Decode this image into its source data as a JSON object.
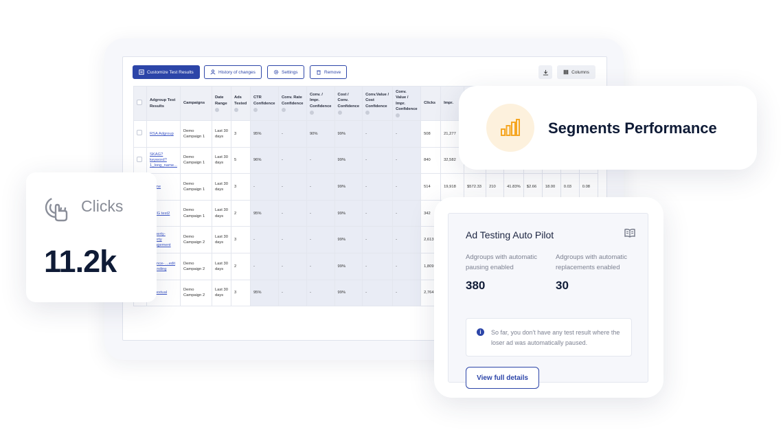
{
  "toolbar": {
    "customize": "Customize Test Results",
    "history": "History of changes",
    "settings": "Settings",
    "remove": "Remove",
    "columns": "Columns"
  },
  "table": {
    "headers": [
      "Adgroup Test Results",
      "Campaigns",
      "Date Range",
      "Ads Tested",
      "CTR Confidence",
      "Conv. Rate Confidence",
      "Conv. / Impr. Confidence",
      "Cost / Conv. Confidence",
      "Conv.Value / Cost Confidence",
      "Conv. Value / Impr. Confidence",
      "Clicks",
      "Impr."
    ],
    "rows": [
      [
        "RSA Adgroup",
        "Demo Campaign 1",
        "Last 30 days",
        "3",
        "95%",
        "-",
        "90%",
        "99%",
        "-",
        "-",
        "508",
        "21,277"
      ],
      [
        "SKAG? keyword?1_long_name...",
        "Demo Campaign 1",
        "Last 30 days",
        "5",
        "96%",
        "-",
        "-",
        "99%",
        "-",
        "-",
        "840",
        "32,582"
      ],
      [
        "...eme",
        "Demo Campaign 1",
        "Last 30 days",
        "3",
        "-",
        "-",
        "-",
        "99%",
        "-",
        "-",
        "514",
        "19,918",
        "$572.33",
        "210",
        "41.83%",
        "$2.66",
        "18.00",
        "0.03",
        "0.08"
      ],
      [
        "...ING test2",
        "Demo Campaign 1",
        "Last 30 days",
        "2",
        "95%",
        "-",
        "-",
        "99%",
        "-",
        "-",
        "342",
        ""
      ],
      [
        "...operty- ...perty ...nagement",
        "Demo Campaign 2",
        "Last 30 days",
        "3",
        "-",
        "-",
        "-",
        "99%",
        "-",
        "-",
        "2,613",
        ""
      ],
      [
        "...rance- ...edit & ...nding",
        "Demo Campaign 2",
        "Last 30 days",
        "2",
        "-",
        "-",
        "-",
        "99%",
        "-",
        "-",
        "1,809",
        ""
      ],
      [
        "...ntextual",
        "Demo Campaign 2",
        "Last 30 days",
        "3",
        "95%",
        "-",
        "-",
        "99%",
        "-",
        "-",
        "2,764",
        ""
      ]
    ]
  },
  "clicks_card": {
    "label": "Clicks",
    "value": "11.2k"
  },
  "segments_card": {
    "title": "Segments Performance"
  },
  "autopilot": {
    "title": "Ad Testing Auto Pilot",
    "left_label": "Adgroups with automatic pausing enabled",
    "left_value": "380",
    "right_label": "Adgroups with automatic replacements enabled",
    "right_value": "30",
    "notice": "So far, you don't have any test result where the loser ad was automatically paused.",
    "button": "View full details"
  },
  "colors": {
    "accent": "#2c45a8",
    "chart_icon": "#f5a623",
    "icon_bg": "#fdf1dd"
  }
}
